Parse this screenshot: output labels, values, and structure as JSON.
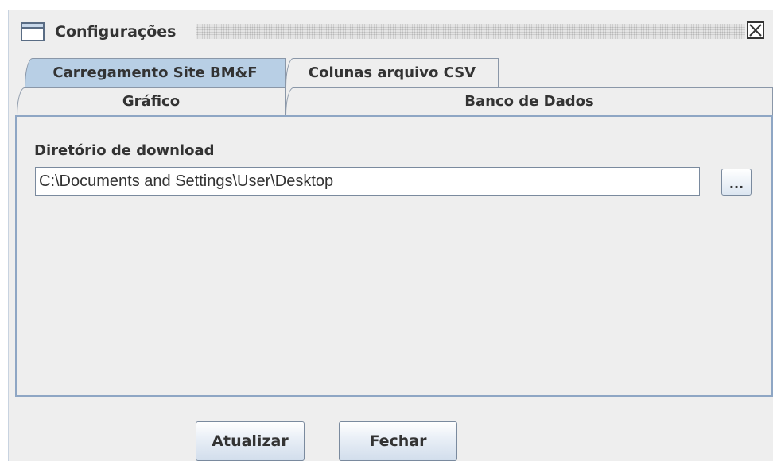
{
  "window": {
    "title": "Configurações",
    "close_icon": "close-box-icon",
    "window_icon": "window-icon"
  },
  "tabs": {
    "row1": [
      {
        "label": "Carregamento Site BM&F",
        "selected": true
      },
      {
        "label": "Colunas arquivo CSV",
        "selected": false
      }
    ],
    "row2": [
      {
        "label": "Gráfico",
        "selected": false
      },
      {
        "label": "Banco de Dados",
        "selected": false
      }
    ]
  },
  "panel": {
    "label": "Diretório de download",
    "directory_value": "C:\\Documents and Settings\\User\\Desktop",
    "browse_label": "..."
  },
  "buttons": {
    "update_label": "Atualizar",
    "close_label": "Fechar"
  },
  "colors": {
    "selected_tab": "#b8cfe5",
    "panel_border": "#8ea6c4",
    "background": "#eeeeee"
  }
}
